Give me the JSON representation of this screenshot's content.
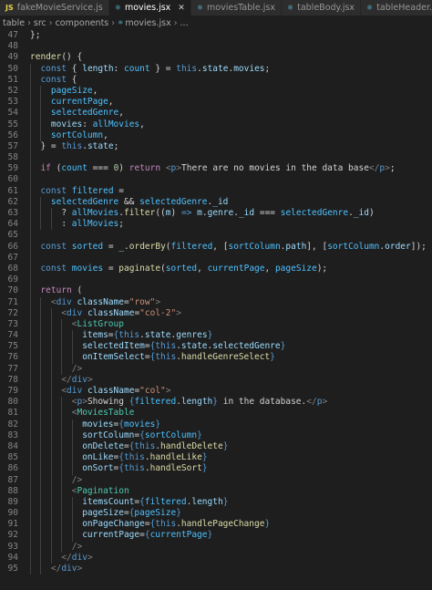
{
  "tabs": [
    {
      "label": "fakeMovieService.js",
      "type": "JS",
      "active": false
    },
    {
      "label": "movies.jsx",
      "type": "JSX",
      "active": true
    },
    {
      "label": "moviesTable.jsx",
      "type": "JSX",
      "active": false
    },
    {
      "label": "tableBody.jsx",
      "type": "JSX",
      "active": false
    },
    {
      "label": "tableHeader.jsx",
      "type": "JSX",
      "active": false
    }
  ],
  "breadcrumb": [
    "table",
    "src",
    "components",
    "movies.jsx",
    "..."
  ],
  "colors": {
    "background": "#1e1e1e",
    "keyword": "#569cd6",
    "string": "#ce9178",
    "component": "#4ec9b0",
    "property": "#9cdcfe",
    "function": "#dcdcaa"
  },
  "code_lines": [
    {
      "n": "47",
      "indent": 1,
      "t": [
        [
          "txt",
          "};"
        ]
      ]
    },
    {
      "n": "48",
      "indent": 1,
      "t": []
    },
    {
      "n": "49",
      "indent": 1,
      "t": [
        [
          "fn",
          "render"
        ],
        [
          "txt",
          "() {"
        ]
      ]
    },
    {
      "n": "50",
      "indent": 2,
      "t": [
        [
          "kw",
          "const"
        ],
        [
          "txt",
          " { "
        ],
        [
          "var",
          "length"
        ],
        [
          "txt",
          ": "
        ],
        [
          "const",
          "count"
        ],
        [
          "txt",
          " } = "
        ],
        [
          "kw",
          "this"
        ],
        [
          "txt",
          "."
        ],
        [
          "var",
          "state"
        ],
        [
          "txt",
          "."
        ],
        [
          "var",
          "movies"
        ],
        [
          "txt",
          ";"
        ]
      ]
    },
    {
      "n": "51",
      "indent": 2,
      "t": [
        [
          "kw",
          "const"
        ],
        [
          "txt",
          " {"
        ]
      ]
    },
    {
      "n": "52",
      "indent": 3,
      "t": [
        [
          "const",
          "pageSize"
        ],
        [
          "txt",
          ","
        ]
      ]
    },
    {
      "n": "53",
      "indent": 3,
      "t": [
        [
          "const",
          "currentPage"
        ],
        [
          "txt",
          ","
        ]
      ]
    },
    {
      "n": "54",
      "indent": 3,
      "t": [
        [
          "const",
          "selectedGenre"
        ],
        [
          "txt",
          ","
        ]
      ]
    },
    {
      "n": "55",
      "indent": 3,
      "t": [
        [
          "var",
          "movies"
        ],
        [
          "txt",
          ": "
        ],
        [
          "const",
          "allMovies"
        ],
        [
          "txt",
          ","
        ]
      ]
    },
    {
      "n": "56",
      "indent": 3,
      "t": [
        [
          "const",
          "sortColumn"
        ],
        [
          "txt",
          ","
        ]
      ]
    },
    {
      "n": "57",
      "indent": 2,
      "t": [
        [
          "txt",
          "} = "
        ],
        [
          "kw",
          "this"
        ],
        [
          "txt",
          "."
        ],
        [
          "var",
          "state"
        ],
        [
          "txt",
          ";"
        ]
      ]
    },
    {
      "n": "58",
      "indent": 2,
      "t": []
    },
    {
      "n": "59",
      "indent": 2,
      "t": [
        [
          "ctl",
          "if"
        ],
        [
          "txt",
          " ("
        ],
        [
          "const",
          "count"
        ],
        [
          "txt",
          " === "
        ],
        [
          "num",
          "0"
        ],
        [
          "txt",
          ") "
        ],
        [
          "ctl",
          "return"
        ],
        [
          "txt",
          " "
        ],
        [
          "punc",
          "<"
        ],
        [
          "tag",
          "p"
        ],
        [
          "punc",
          ">"
        ],
        [
          "txt",
          "There are no movies in the data base"
        ],
        [
          "punc",
          "</"
        ],
        [
          "tag",
          "p"
        ],
        [
          "punc",
          ">"
        ],
        [
          "txt",
          ";"
        ]
      ]
    },
    {
      "n": "60",
      "indent": 2,
      "t": []
    },
    {
      "n": "61",
      "indent": 2,
      "t": [
        [
          "kw",
          "const"
        ],
        [
          "txt",
          " "
        ],
        [
          "const",
          "filtered"
        ],
        [
          "txt",
          " ="
        ]
      ]
    },
    {
      "n": "62",
      "indent": 3,
      "t": [
        [
          "const",
          "selectedGenre"
        ],
        [
          "txt",
          " && "
        ],
        [
          "const",
          "selectedGenre"
        ],
        [
          "txt",
          "."
        ],
        [
          "var",
          "_id"
        ]
      ]
    },
    {
      "n": "63",
      "indent": 4,
      "t": [
        [
          "txt",
          "? "
        ],
        [
          "const",
          "allMovies"
        ],
        [
          "txt",
          "."
        ],
        [
          "fn",
          "filter"
        ],
        [
          "txt",
          "(("
        ],
        [
          "var",
          "m"
        ],
        [
          "txt",
          ") "
        ],
        [
          "kw",
          "=>"
        ],
        [
          "txt",
          " "
        ],
        [
          "var",
          "m"
        ],
        [
          "txt",
          "."
        ],
        [
          "var",
          "genre"
        ],
        [
          "txt",
          "."
        ],
        [
          "var",
          "_id"
        ],
        [
          "txt",
          " === "
        ],
        [
          "const",
          "selectedGenre"
        ],
        [
          "txt",
          "."
        ],
        [
          "var",
          "_id"
        ],
        [
          "txt",
          ")"
        ]
      ]
    },
    {
      "n": "64",
      "indent": 4,
      "t": [
        [
          "txt",
          ": "
        ],
        [
          "const",
          "allMovies"
        ],
        [
          "txt",
          ";"
        ]
      ]
    },
    {
      "n": "65",
      "indent": 2,
      "t": []
    },
    {
      "n": "66",
      "indent": 2,
      "t": [
        [
          "kw",
          "const"
        ],
        [
          "txt",
          " "
        ],
        [
          "const",
          "sorted"
        ],
        [
          "txt",
          " = "
        ],
        [
          "var",
          "_"
        ],
        [
          "txt",
          "."
        ],
        [
          "fn",
          "orderBy"
        ],
        [
          "txt",
          "("
        ],
        [
          "const",
          "filtered"
        ],
        [
          "txt",
          ", ["
        ],
        [
          "const",
          "sortColumn"
        ],
        [
          "txt",
          "."
        ],
        [
          "var",
          "path"
        ],
        [
          "txt",
          "], ["
        ],
        [
          "const",
          "sortColumn"
        ],
        [
          "txt",
          "."
        ],
        [
          "var",
          "order"
        ],
        [
          "txt",
          "]);"
        ]
      ]
    },
    {
      "n": "67",
      "indent": 2,
      "t": []
    },
    {
      "n": "68",
      "indent": 2,
      "t": [
        [
          "kw",
          "const"
        ],
        [
          "txt",
          " "
        ],
        [
          "const",
          "movies"
        ],
        [
          "txt",
          " = "
        ],
        [
          "fn",
          "paginate"
        ],
        [
          "txt",
          "("
        ],
        [
          "const",
          "sorted"
        ],
        [
          "txt",
          ", "
        ],
        [
          "const",
          "currentPage"
        ],
        [
          "txt",
          ", "
        ],
        [
          "const",
          "pageSize"
        ],
        [
          "txt",
          ");"
        ]
      ]
    },
    {
      "n": "69",
      "indent": 2,
      "t": []
    },
    {
      "n": "70",
      "indent": 2,
      "t": [
        [
          "ctl",
          "return"
        ],
        [
          "txt",
          " ("
        ]
      ]
    },
    {
      "n": "71",
      "indent": 3,
      "t": [
        [
          "punc",
          "<"
        ],
        [
          "tag",
          "div"
        ],
        [
          "txt",
          " "
        ],
        [
          "attr",
          "className"
        ],
        [
          "txt",
          "="
        ],
        [
          "str",
          "\"row\""
        ],
        [
          "punc",
          ">"
        ]
      ]
    },
    {
      "n": "72",
      "indent": 4,
      "t": [
        [
          "punc",
          "<"
        ],
        [
          "tag",
          "div"
        ],
        [
          "txt",
          " "
        ],
        [
          "attr",
          "className"
        ],
        [
          "txt",
          "="
        ],
        [
          "str",
          "\"col-2\""
        ],
        [
          "punc",
          ">"
        ]
      ]
    },
    {
      "n": "73",
      "indent": 5,
      "t": [
        [
          "punc",
          "<"
        ],
        [
          "comp",
          "ListGroup"
        ]
      ]
    },
    {
      "n": "74",
      "indent": 6,
      "t": [
        [
          "attr",
          "items"
        ],
        [
          "txt",
          "="
        ],
        [
          "kw",
          "{"
        ],
        [
          "kw",
          "this"
        ],
        [
          "txt",
          "."
        ],
        [
          "var",
          "state"
        ],
        [
          "txt",
          "."
        ],
        [
          "var",
          "genres"
        ],
        [
          "kw",
          "}"
        ]
      ]
    },
    {
      "n": "75",
      "indent": 6,
      "t": [
        [
          "attr",
          "selectedItem"
        ],
        [
          "txt",
          "="
        ],
        [
          "kw",
          "{"
        ],
        [
          "kw",
          "this"
        ],
        [
          "txt",
          "."
        ],
        [
          "var",
          "state"
        ],
        [
          "txt",
          "."
        ],
        [
          "var",
          "selectedGenre"
        ],
        [
          "kw",
          "}"
        ]
      ]
    },
    {
      "n": "76",
      "indent": 6,
      "t": [
        [
          "attr",
          "onItemSelect"
        ],
        [
          "txt",
          "="
        ],
        [
          "kw",
          "{"
        ],
        [
          "kw",
          "this"
        ],
        [
          "txt",
          "."
        ],
        [
          "fn",
          "handleGenreSelect"
        ],
        [
          "kw",
          "}"
        ]
      ]
    },
    {
      "n": "77",
      "indent": 5,
      "t": [
        [
          "punc",
          "/>"
        ]
      ]
    },
    {
      "n": "78",
      "indent": 4,
      "t": [
        [
          "punc",
          "</"
        ],
        [
          "tag",
          "div"
        ],
        [
          "punc",
          ">"
        ]
      ]
    },
    {
      "n": "79",
      "indent": 4,
      "t": [
        [
          "punc",
          "<"
        ],
        [
          "tag",
          "div"
        ],
        [
          "txt",
          " "
        ],
        [
          "attr",
          "className"
        ],
        [
          "txt",
          "="
        ],
        [
          "str",
          "\"col\""
        ],
        [
          "punc",
          ">"
        ]
      ]
    },
    {
      "n": "80",
      "indent": 5,
      "t": [
        [
          "punc",
          "<"
        ],
        [
          "tag",
          "p"
        ],
        [
          "punc",
          ">"
        ],
        [
          "txt",
          "Showing "
        ],
        [
          "kw",
          "{"
        ],
        [
          "const",
          "filtered"
        ],
        [
          "txt",
          "."
        ],
        [
          "var",
          "length"
        ],
        [
          "kw",
          "}"
        ],
        [
          "txt",
          " in the database."
        ],
        [
          "punc",
          "</"
        ],
        [
          "tag",
          "p"
        ],
        [
          "punc",
          ">"
        ]
      ]
    },
    {
      "n": "81",
      "indent": 5,
      "t": [
        [
          "punc",
          "<"
        ],
        [
          "comp",
          "MoviesTable"
        ]
      ]
    },
    {
      "n": "82",
      "indent": 6,
      "t": [
        [
          "attr",
          "movies"
        ],
        [
          "txt",
          "="
        ],
        [
          "kw",
          "{"
        ],
        [
          "const",
          "movies"
        ],
        [
          "kw",
          "}"
        ]
      ]
    },
    {
      "n": "83",
      "indent": 6,
      "t": [
        [
          "attr",
          "sortColumn"
        ],
        [
          "txt",
          "="
        ],
        [
          "kw",
          "{"
        ],
        [
          "const",
          "sortColumn"
        ],
        [
          "kw",
          "}"
        ]
      ]
    },
    {
      "n": "84",
      "indent": 6,
      "t": [
        [
          "attr",
          "onDelete"
        ],
        [
          "txt",
          "="
        ],
        [
          "kw",
          "{"
        ],
        [
          "kw",
          "this"
        ],
        [
          "txt",
          "."
        ],
        [
          "fn",
          "handleDelete"
        ],
        [
          "kw",
          "}"
        ]
      ]
    },
    {
      "n": "85",
      "indent": 6,
      "t": [
        [
          "attr",
          "onLike"
        ],
        [
          "txt",
          "="
        ],
        [
          "kw",
          "{"
        ],
        [
          "kw",
          "this"
        ],
        [
          "txt",
          "."
        ],
        [
          "fn",
          "handleLike"
        ],
        [
          "kw",
          "}"
        ]
      ]
    },
    {
      "n": "86",
      "indent": 6,
      "t": [
        [
          "attr",
          "onSort"
        ],
        [
          "txt",
          "="
        ],
        [
          "kw",
          "{"
        ],
        [
          "kw",
          "this"
        ],
        [
          "txt",
          "."
        ],
        [
          "fn",
          "handleSort"
        ],
        [
          "kw",
          "}"
        ]
      ]
    },
    {
      "n": "87",
      "indent": 5,
      "t": [
        [
          "punc",
          "/>"
        ]
      ]
    },
    {
      "n": "88",
      "indent": 5,
      "t": [
        [
          "punc",
          "<"
        ],
        [
          "comp",
          "Pagination"
        ]
      ]
    },
    {
      "n": "89",
      "indent": 6,
      "t": [
        [
          "attr",
          "itemsCount"
        ],
        [
          "txt",
          "="
        ],
        [
          "kw",
          "{"
        ],
        [
          "const",
          "filtered"
        ],
        [
          "txt",
          "."
        ],
        [
          "var",
          "length"
        ],
        [
          "kw",
          "}"
        ]
      ]
    },
    {
      "n": "90",
      "indent": 6,
      "t": [
        [
          "attr",
          "pageSize"
        ],
        [
          "txt",
          "="
        ],
        [
          "kw",
          "{"
        ],
        [
          "const",
          "pageSize"
        ],
        [
          "kw",
          "}"
        ]
      ]
    },
    {
      "n": "91",
      "indent": 6,
      "t": [
        [
          "attr",
          "onPageChange"
        ],
        [
          "txt",
          "="
        ],
        [
          "kw",
          "{"
        ],
        [
          "kw",
          "this"
        ],
        [
          "txt",
          "."
        ],
        [
          "fn",
          "handlePageChange"
        ],
        [
          "kw",
          "}"
        ]
      ]
    },
    {
      "n": "92",
      "indent": 6,
      "t": [
        [
          "attr",
          "currentPage"
        ],
        [
          "txt",
          "="
        ],
        [
          "kw",
          "{"
        ],
        [
          "const",
          "currentPage"
        ],
        [
          "kw",
          "}"
        ]
      ]
    },
    {
      "n": "93",
      "indent": 5,
      "t": [
        [
          "punc",
          "/>"
        ]
      ]
    },
    {
      "n": "94",
      "indent": 4,
      "t": [
        [
          "punc",
          "</"
        ],
        [
          "tag",
          "div"
        ],
        [
          "punc",
          ">"
        ]
      ]
    },
    {
      "n": "95",
      "indent": 3,
      "t": [
        [
          "punc",
          "</"
        ],
        [
          "tag",
          "div"
        ],
        [
          "punc",
          ">"
        ]
      ]
    }
  ]
}
